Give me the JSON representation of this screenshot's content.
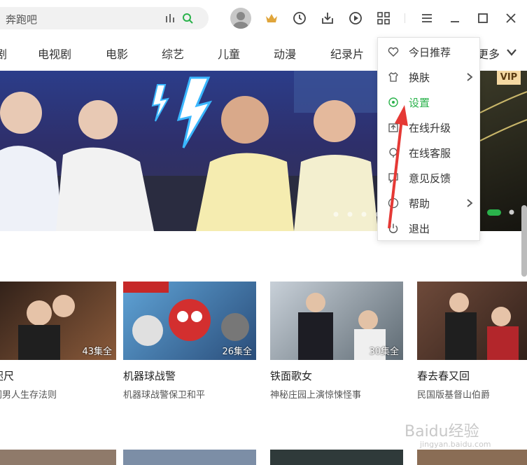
{
  "search": {
    "placeholder": "奔跑吧"
  },
  "nav": {
    "items": [
      "剧",
      "电视剧",
      "电影",
      "综艺",
      "儿童",
      "动漫",
      "纪录片",
      "更多"
    ]
  },
  "banner": {
    "vip_label": "VIP"
  },
  "menu": {
    "items": [
      {
        "label": "今日推荐",
        "icon": "heart-icon",
        "submenu": false
      },
      {
        "label": "换肤",
        "icon": "shirt-icon",
        "submenu": true
      },
      {
        "label": "设置",
        "icon": "settings-icon",
        "submenu": false,
        "active": true
      },
      {
        "label": "在线升级",
        "icon": "upgrade-icon",
        "submenu": false
      },
      {
        "label": "在线客服",
        "icon": "support-icon",
        "submenu": false
      },
      {
        "label": "意见反馈",
        "icon": "feedback-icon",
        "submenu": false
      },
      {
        "label": "帮助",
        "icon": "help-icon",
        "submenu": true
      },
      {
        "label": "退出",
        "icon": "power-icon",
        "submenu": false
      }
    ]
  },
  "cards": [
    {
      "title": "咫尺",
      "subtitle": "闻男人生存法则",
      "badge": "43集全"
    },
    {
      "title": "机器球战警",
      "subtitle": "机器球战警保卫和平",
      "badge": "26集全"
    },
    {
      "title": "铁面歌女",
      "subtitle": "神秘庄园上演惊悚怪事",
      "badge": "30集全"
    },
    {
      "title": "春去春又回",
      "subtitle": "民国版基督山伯爵",
      "badge": ""
    }
  ],
  "watermark": {
    "text": "Baidu经验",
    "sub": "jingyan.baidu.com"
  },
  "colors": {
    "accent": "#2ab24b",
    "annotation_arrow": "#e53935"
  }
}
